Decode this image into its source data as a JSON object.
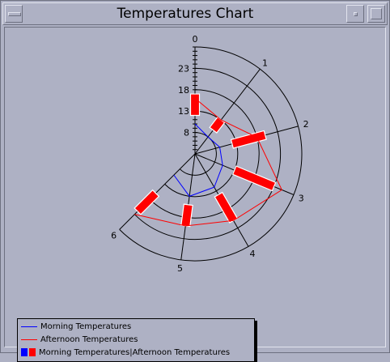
{
  "window": {
    "title": "Temperatures Chart"
  },
  "colors": {
    "morning": "#0000ff",
    "afternoon": "#ff0000",
    "bars": "#ff0000",
    "axis": "#000000"
  },
  "chart_data": {
    "type": "radar",
    "angle_categories": [
      "0",
      "1",
      "2",
      "3",
      "4",
      "5",
      "6"
    ],
    "radial_ticks": [
      "8",
      "13",
      "18",
      "23"
    ],
    "rlim": [
      3,
      28
    ],
    "series": [
      {
        "name": "Morning Temperatures",
        "values": [
          10,
          8,
          9,
          10,
          12,
          13,
          10
        ]
      },
      {
        "name": "Afternoon Temperatures",
        "values": [
          16,
          13,
          18,
          25,
          21,
          20,
          23
        ]
      }
    ],
    "bars": {
      "name": "Morning Temperatures|Afternoon Temperatures",
      "low": [
        12,
        10,
        12,
        13,
        14,
        15,
        16
      ],
      "high": [
        17,
        13,
        20,
        23,
        21,
        20,
        22
      ]
    }
  },
  "legend": {
    "items": [
      {
        "label": "Morning Temperatures"
      },
      {
        "label": "Afternoon Temperatures"
      },
      {
        "label": "Morning Temperatures|Afternoon Temperatures"
      }
    ]
  }
}
